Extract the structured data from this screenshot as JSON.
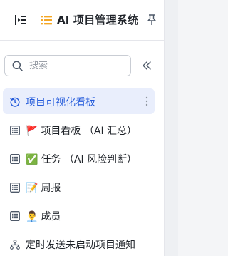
{
  "header": {
    "title": "AI 项目管理系统",
    "icons": {
      "collapse": "indent-collapse-icon",
      "list": "list-icon",
      "pin": "pin-icon"
    }
  },
  "search": {
    "placeholder": "搜索",
    "icon": "search-icon",
    "fold_icon": "double-chevron-left-icon"
  },
  "nav": {
    "items": [
      {
        "label": "项目可视化看板",
        "icon": "clock-refresh-icon",
        "emoji": "",
        "active": true
      },
      {
        "label": "项目看板 （AI 汇总）",
        "icon": "table-icon",
        "emoji": "🚩",
        "active": false
      },
      {
        "label": "任务 （AI 风险判断）",
        "icon": "table-icon",
        "emoji": "✅",
        "active": false
      },
      {
        "label": "周报",
        "icon": "table-icon",
        "emoji": "📝",
        "active": false
      },
      {
        "label": "成员",
        "icon": "table-icon",
        "emoji": "👨‍💼",
        "active": false
      },
      {
        "label": "定时发送未启动项目通知",
        "icon": "workflow-icon",
        "emoji": "",
        "active": false
      }
    ]
  },
  "colors": {
    "accent": "#245bdb",
    "active_bg": "#e9eefc",
    "title_icon": "#f5a623"
  }
}
